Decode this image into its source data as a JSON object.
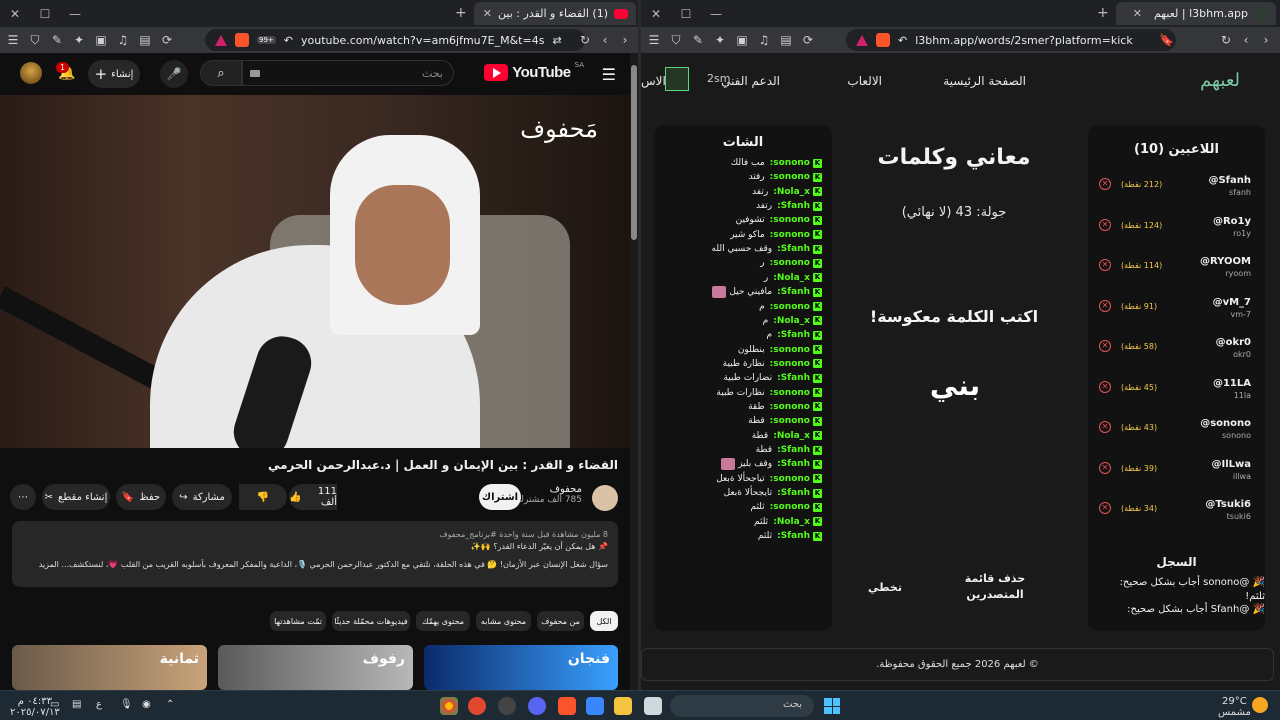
{
  "left_window": {
    "tab_title": "(1) القضاء و القدر : بين الإيمان و",
    "url": "youtube.com/watch?v=am6jfmu7E_M&t=4s",
    "shield_count": "99+"
  },
  "youtube": {
    "logo_text": "YouTube",
    "country": "SA",
    "search_placeholder": "بحث",
    "create_label": "إنشاء",
    "notif_count": "1",
    "video_brand": "مَحفوف",
    "video_title": "القضاء و القدر : بين الإيمان و العمل | د.عبدالرحمن الحرمي",
    "channel_name": "محفوف",
    "channel_subs": "785 ألف مشترك",
    "subscribe_label": "اشتراك",
    "like_count": "111 ألف",
    "share_label": "مشاركة",
    "save_label": "حفظ",
    "clip_label": "إنشاء مقطع",
    "desc_line1": "8 مليون مشاهدة قبل سنة واحدة #برنامج_محفوف",
    "desc_line2": "📌 هل يمكن أن يغيّر الدعاء القدر؟ 🙌✨",
    "desc_line3": "سؤال شغل الإنسان عبر الأزمان! 🤔 في هذه الحلقة، نلتقي مع الدكتور عبدالرحمن الحرمي 🎙️، الداعية والمفكر المعروف بأسلوبه القريب من القلب 💗، لنستكشف... المزيد",
    "chips": [
      "الكل",
      "من محفوف",
      "محتوى مشابه",
      "محتوى يهمّك",
      "فيديوهات محمّلة حديثًا",
      "تمّت مشاهدتها"
    ],
    "thumbs": [
      {
        "title": "ثمانية"
      },
      {
        "title": "رفوف"
      },
      {
        "title": "فنجان"
      }
    ]
  },
  "right_window": {
    "tab_title": "l3bhm.app | لعبهم",
    "url": "l3bhm.app/words/2smer?platform=kick"
  },
  "site": {
    "logo": "لعبهم",
    "nav": [
      "الصفحة الرئيسية",
      "الالعاب",
      "الدعم الفني",
      "الاس"
    ],
    "user": "2sm"
  },
  "players": {
    "title": "اللاعبين (10)",
    "list": [
      {
        "name": "@Sfanh",
        "user": "sfanh",
        "points": "(212 نقطة)"
      },
      {
        "name": "@Ro1y",
        "user": "ro1y",
        "points": "(124 نقطة)"
      },
      {
        "name": "@RYOOM",
        "user": "ryoom",
        "points": "(114 نقطة)"
      },
      {
        "name": "@vM_7",
        "user": "vm-7",
        "points": "(91 نقطة)"
      },
      {
        "name": "@okr0",
        "user": "okr0",
        "points": "(58 نقطة)"
      },
      {
        "name": "@11LA",
        "user": "11la",
        "points": "(45 نقطة)"
      },
      {
        "name": "@sonono",
        "user": "sonono",
        "points": "(43 نقطة)"
      },
      {
        "name": "@IlLwa",
        "user": "illwa",
        "points": "(39 نقطة)"
      },
      {
        "name": "@Tsuki6",
        "user": "tsuki6",
        "points": "(34 نقطة)"
      }
    ]
  },
  "log": {
    "title": "السجل",
    "lines": [
      "🎉 @sonono أجاب بشكل صحيح:",
      "ثلثم!",
      "🎉 @Sfanh أجاب بشكل صحيح:"
    ]
  },
  "game": {
    "title": "معاني وكلمات",
    "round": "جولة: 43 (لا نهائي)",
    "prompt": "اكتب الكلمة معكوسة!",
    "word": "بني",
    "btn_clear": "حذف قائمة المتصدرين",
    "btn_skip": "تخطي"
  },
  "chat": {
    "title": "الشات",
    "messages": [
      {
        "user": "sonono:",
        "text": "مب فالك"
      },
      {
        "user": "sonono:",
        "text": "رفتد"
      },
      {
        "user": "Nola_x:",
        "text": "رتفد"
      },
      {
        "user": "Sfanh:",
        "text": "رتفد"
      },
      {
        "user": "sonono:",
        "text": "تشوفين"
      },
      {
        "user": "sonono:",
        "text": "ماكو شير"
      },
      {
        "user": "Sfanh:",
        "text": "وقف حسبي الله"
      },
      {
        "user": "sonono:",
        "text": "ر"
      },
      {
        "user": "Nola_x:",
        "text": "ر"
      },
      {
        "user": "Sfanh:",
        "text": "مافيني حيل",
        "emote": true
      },
      {
        "user": "sonono:",
        "text": "م"
      },
      {
        "user": "Nola_x:",
        "text": "م"
      },
      {
        "user": "Sfanh:",
        "text": "م"
      },
      {
        "user": "sonono:",
        "text": "بنطلون"
      },
      {
        "user": "sonono:",
        "text": "نظارة طبية"
      },
      {
        "user": "Sfanh:",
        "text": "نضارات طبية"
      },
      {
        "user": "sonono:",
        "text": "نظارات طبية"
      },
      {
        "user": "sonono:",
        "text": "طقة"
      },
      {
        "user": "sonono:",
        "text": "قطة"
      },
      {
        "user": "Nola_x:",
        "text": "قطة"
      },
      {
        "user": "Sfanh:",
        "text": "قطة"
      },
      {
        "user": "Sfanh:",
        "text": "وقف بليز",
        "emote": true
      },
      {
        "user": "sonono:",
        "text": "تياجحألا ةبعل"
      },
      {
        "user": "Sfanh:",
        "text": "تايجحألا ةبعل"
      },
      {
        "user": "sonono:",
        "text": "ثلثم"
      },
      {
        "user": "Nola_x:",
        "text": "ثلثم"
      },
      {
        "user": "Sfanh:",
        "text": "ثلثم"
      }
    ]
  },
  "footer": "© لعبهم 2026 جميع الحقوق محفوظة.",
  "taskbar": {
    "search": "بحث",
    "temp": "29°C",
    "weather": "مشمس",
    "time": "٠٤:٣٣ م",
    "date": "٢٠٢٥/٠٧/١٣",
    "lang": "ع"
  }
}
